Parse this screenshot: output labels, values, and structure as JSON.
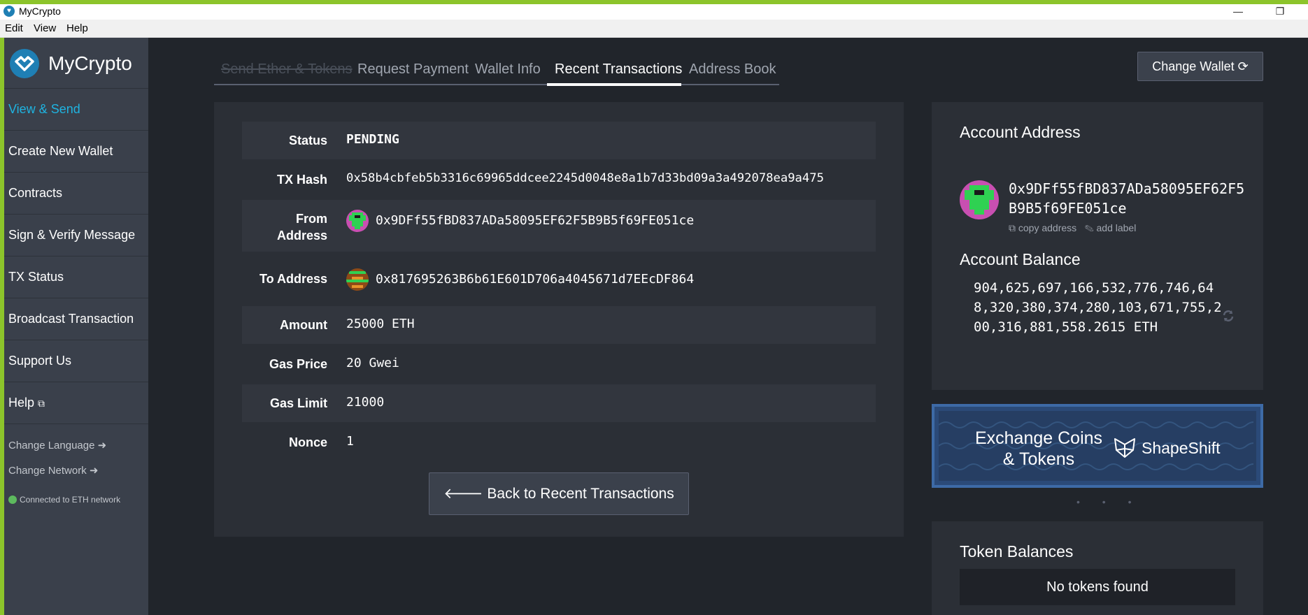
{
  "window": {
    "title": "MyCrypto",
    "minimize": "—",
    "restore": "❐"
  },
  "menu": [
    "Edit",
    "View",
    "Help"
  ],
  "sidebar": {
    "brand": "MyCrypto",
    "items": [
      {
        "label": "View & Send",
        "active": true
      },
      {
        "label": "Create New Wallet"
      },
      {
        "label": "Contracts"
      },
      {
        "label": "Sign & Verify Message"
      },
      {
        "label": "TX Status"
      },
      {
        "label": "Broadcast Transaction"
      },
      {
        "label": "Support Us"
      },
      {
        "label": "Help"
      }
    ],
    "change_language": "Change Language",
    "change_network": "Change Network",
    "network_status": "Connected to ETH network"
  },
  "tabs": [
    {
      "label": "Send Ether & Tokens",
      "disabled": true
    },
    {
      "label": "Request Payment"
    },
    {
      "label": "Wallet Info"
    },
    {
      "label": "Recent Transactions",
      "active": true
    },
    {
      "label": "Address Book"
    }
  ],
  "change_wallet_label": "Change Wallet",
  "tx": {
    "status_label": "Status",
    "status": "PENDING",
    "hash_label": "TX Hash",
    "hash": "0x58b4cbfeb5b3316c69965ddcee2245d0048e8a1b7d33bd09a3a492078ea9a475",
    "from_label_1": "From",
    "from_label_2": "Address",
    "from": "0x9DFf55fBD837ADa58095EF62F5B9B5f69FE051ce",
    "to_label": "To Address",
    "to": "0x817695263B6b61E601D706a4045671d7EEcDF864",
    "amount_label": "Amount",
    "amount": "25000 ETH",
    "gas_price_label": "Gas Price",
    "gas_price": "20 Gwei",
    "gas_limit_label": "Gas Limit",
    "gas_limit": "21000",
    "nonce_label": "Nonce",
    "nonce": "1"
  },
  "back_button": "Back to Recent Transactions",
  "account": {
    "address_title": "Account Address",
    "address": "0x9DFf55fBD837ADa58095EF62F5B9B5f69FE051ce",
    "copy_label": "copy address",
    "add_label": "add label",
    "balance_title": "Account Balance",
    "balance": "904,625,697,166,532,776,746,648,320,380,374,280,103,671,755,200,316,881,558.2615 ETH"
  },
  "shapeshift": {
    "line1": "Exchange Coins",
    "line2": "& Tokens",
    "brand": "ShapeShift"
  },
  "carousel_dots": "• • •",
  "tokens": {
    "title": "Token Balances",
    "empty": "No tokens found"
  },
  "colors": {
    "accent": "#1fb3e0",
    "pending": "#f6a525",
    "green": "#8cc42b"
  }
}
